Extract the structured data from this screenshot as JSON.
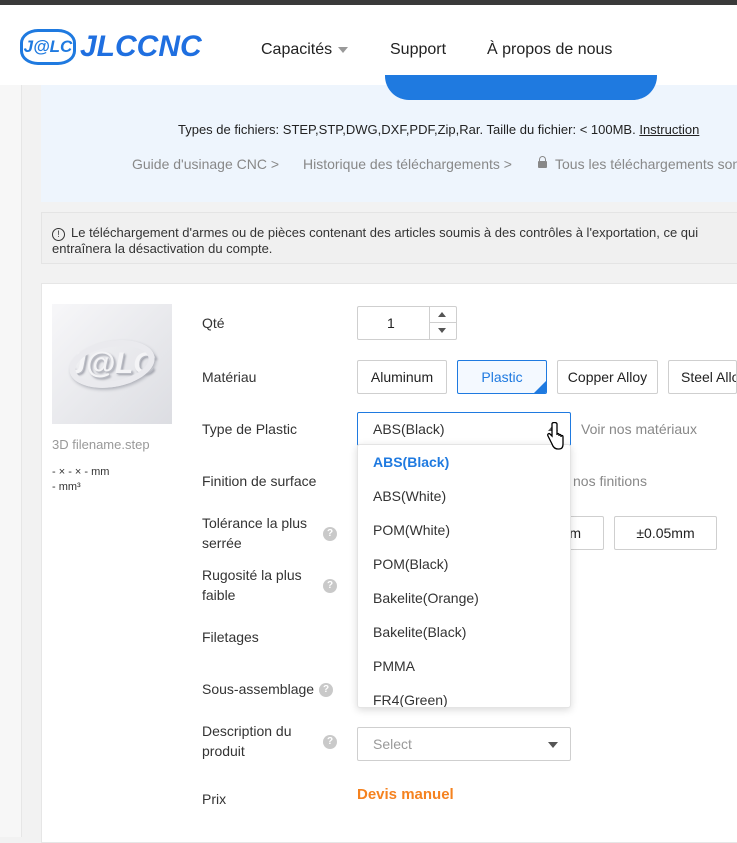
{
  "header": {
    "logo_badge": "J@LC",
    "logo_text": "JLCCNC",
    "nav": [
      {
        "label": "Capacités"
      },
      {
        "label": "Support"
      },
      {
        "label": "À propos de nous"
      }
    ]
  },
  "upload": {
    "file_types_text": "Types de fichiers: STEP,STP,DWG,DXF,PDF,Zip,Rar. Taille du fichier: < 100MB.",
    "instructions_link": "Instruction",
    "breadcrumbs": [
      "Guide d'usinage CNC >",
      "Historique des téléchargements >",
      "Tous les téléchargements sont"
    ]
  },
  "warning": {
    "line1": "Le téléchargement d'armes ou de pièces contenant des articles soumis à des contrôles à l'exportation, ce qui",
    "line2": "entraînera la désactivation du compte."
  },
  "part": {
    "filename": "3D filename.step",
    "dims_line1": "- × - × - mm",
    "dims_line2": "- mm³"
  },
  "form": {
    "qty_label": "Qté",
    "qty_value": "1",
    "material_label": "Matériau",
    "materials": [
      "Aluminum",
      "Plastic",
      "Copper Alloy",
      "Steel Allo"
    ],
    "selected_material": "Plastic",
    "plastic_type_label": "Type de Plastic",
    "plastic_type_value": "ABS(Black)",
    "view_materials_link": "Voir nos matériaux",
    "finish_label": "Finition de surface",
    "view_finishes_link": "Voir nos finitions",
    "tolerance_label_1": "Tolérance la plus",
    "tolerance_label_2": "serrée",
    "tolerance_options": [
      "m",
      "±0.05mm"
    ],
    "roughness_label_1": "Rugosité la plus",
    "roughness_label_2": "faible",
    "threads_label": "Filetages",
    "subassembly_label": "Sous-assemblage",
    "description_label_1": "Description du",
    "description_label_2": "produit",
    "description_placeholder": "Select",
    "price_label": "Prix",
    "price_value": "Devis manuel"
  },
  "dropdown": {
    "options": [
      "ABS(Black)",
      "ABS(White)",
      "POM(White)",
      "POM(Black)",
      "Bakelite(Orange)",
      "Bakelite(Black)",
      "PMMA",
      "FR4(Green)"
    ],
    "selected": "ABS(Black)"
  },
  "colors": {
    "accent": "#1f7ae0",
    "price": "#f5821f"
  }
}
